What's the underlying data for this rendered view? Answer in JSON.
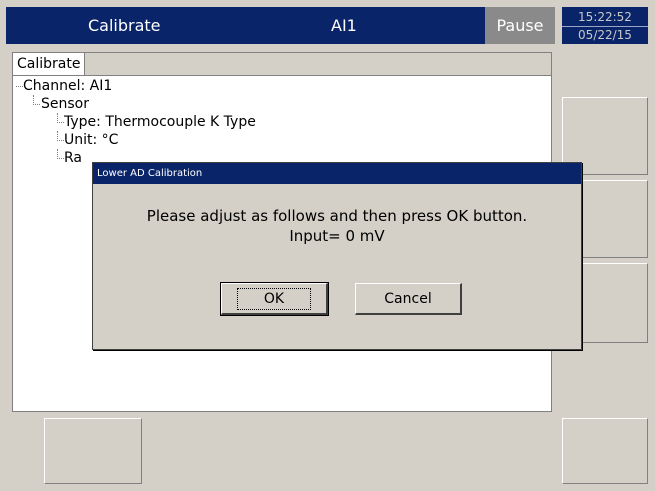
{
  "header": {
    "title": "Calibrate",
    "channel": "AI1",
    "pause_label": "Pause"
  },
  "clock": {
    "time": "15:22:52",
    "date": "05/22/15"
  },
  "panel": {
    "tab_label": "Calibrate"
  },
  "tree": {
    "channel": "Channel: AI1",
    "sensor": "Sensor",
    "type": "Type: Thermocouple K Type",
    "unit": "Unit: °C",
    "range_partial": "Ra"
  },
  "dialog": {
    "title": "Lower AD Calibration",
    "message_line1": "Please adjust as follows and then press OK button.",
    "message_line2": "Input= 0 mV",
    "ok_label": "OK",
    "cancel_label": "Cancel"
  }
}
